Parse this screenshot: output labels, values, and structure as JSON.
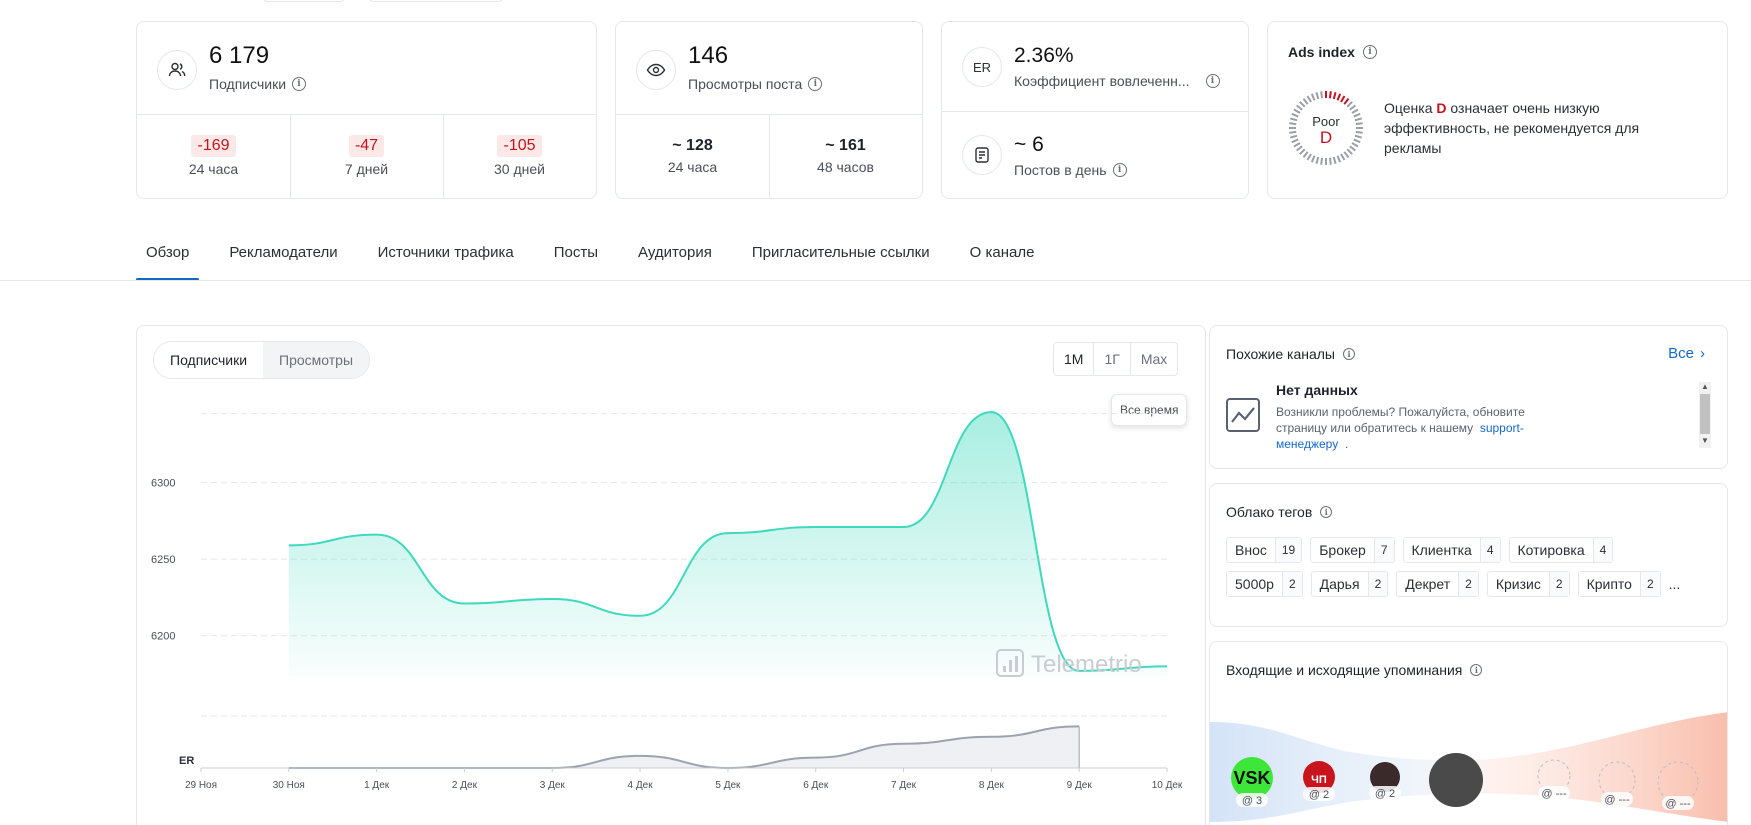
{
  "stats": {
    "subscribers": {
      "value": "6 179",
      "label": "Подписчики",
      "cells": [
        {
          "delta": "-169",
          "period": "24 часа"
        },
        {
          "delta": "-47",
          "period": "7 дней"
        },
        {
          "delta": "-105",
          "period": "30 дней"
        }
      ]
    },
    "views": {
      "value": "146",
      "label": "Просмотры поста",
      "cells": [
        {
          "value": "~ 128",
          "period": "24 часа"
        },
        {
          "value": "~ 161",
          "period": "48 часов"
        }
      ]
    },
    "er": {
      "icon_text": "ER",
      "value": "2.36%",
      "label": "Коэффициент вовлеченн...",
      "posts_value": "~ 6",
      "posts_label": "Постов в день"
    },
    "ads": {
      "title": "Ads index",
      "grade_word": "Poor",
      "grade_letter": "D",
      "desc_prefix": "Оценка ",
      "desc_grade": "D",
      "desc_suffix": " означает очень низкую эффективность, не рекомендуется для рекламы"
    }
  },
  "tabs": [
    "Обзор",
    "Рекламодатели",
    "Источники трафика",
    "Посты",
    "Аудитория",
    "Пригласительные ссылки",
    "О канале"
  ],
  "chart_panel": {
    "seg": [
      "Подписчики",
      "Просмотры"
    ],
    "ranges": [
      "1М",
      "1Г",
      "Max"
    ],
    "tooltip": "Все время",
    "watermark": "Telemetrio",
    "er_label": "ER"
  },
  "chart_data": {
    "type": "area",
    "x": [
      "29 Ноя",
      "30 Ноя",
      "1 Дек",
      "2 Дек",
      "3 Дек",
      "4 Дек",
      "5 Дек",
      "6 Дек",
      "7 Дек",
      "8 Дек",
      "9 Дек",
      "10 Дек"
    ],
    "yticks": [
      6200,
      6250,
      6300
    ],
    "ylim": [
      6175,
      6350
    ],
    "series": [
      {
        "values": [
          null,
          6259,
          6266,
          6221,
          6224,
          6213,
          6267,
          6271,
          6271,
          6346,
          6177,
          6180
        ]
      }
    ],
    "er_series": [
      null,
      0.0,
      0.0,
      0.0,
      0.0,
      0.35,
      0.0,
      0.3,
      0.7,
      0.9,
      1.2,
      null
    ]
  },
  "similar": {
    "title": "Похожие каналы",
    "all_link": "Все",
    "empty_title": "Нет данных",
    "empty_text": "Возникли проблемы? Пожалуйста, обновите страницу или обратитесь к нашему",
    "support_link": "support-менеджеру",
    "empty_end": "."
  },
  "tags": {
    "title": "Облако тегов",
    "row1": [
      {
        "t": "Внос",
        "c": "19"
      },
      {
        "t": "Брокер",
        "c": "7"
      },
      {
        "t": "Клиентка",
        "c": "4"
      },
      {
        "t": "Котировка",
        "c": "4"
      }
    ],
    "row2": [
      {
        "t": "5000р",
        "c": "2"
      },
      {
        "t": "Дарья",
        "c": "2"
      },
      {
        "t": "Декрет",
        "c": "2"
      },
      {
        "t": "Кризис",
        "c": "2"
      },
      {
        "t": "Крипто",
        "c": "2"
      }
    ],
    "more": "..."
  },
  "mentions": {
    "title": "Входящие и исходящие упоминания",
    "items": [
      {
        "label": "VSK",
        "count": "@ 3",
        "color": "#3ee63a"
      },
      {
        "label": "ЧП",
        "count": "@ 2",
        "color": "#c8141c"
      },
      {
        "label": "",
        "count": "@ 2",
        "color": "#3a2a2a"
      },
      {
        "label": "",
        "count": "",
        "color": "#4a4a4a"
      },
      {
        "label": "",
        "count": "@ ---",
        "color": ""
      },
      {
        "label": "",
        "count": "@ ---",
        "color": ""
      },
      {
        "label": "",
        "count": "@ ---",
        "color": ""
      }
    ]
  },
  "colors": {
    "accent": "#1668c7",
    "area": "#3fd9bd",
    "negative": "#c4131f"
  }
}
